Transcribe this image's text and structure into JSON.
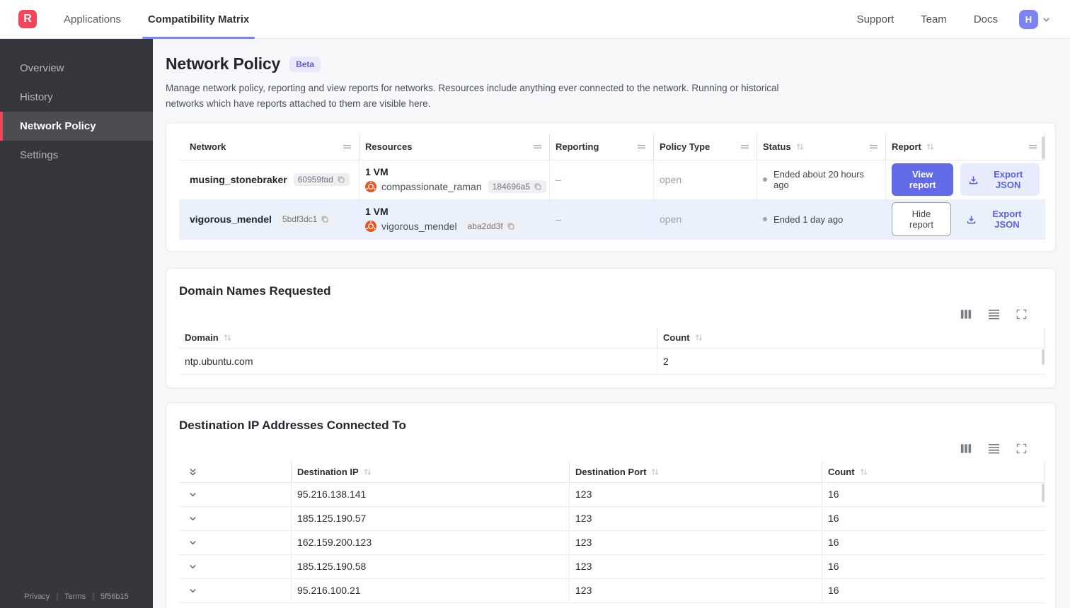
{
  "topnav": {
    "logo_letter": "R",
    "tabs": [
      {
        "label": "Applications"
      },
      {
        "label": "Compatibility Matrix"
      }
    ],
    "links": [
      {
        "label": "Support"
      },
      {
        "label": "Team"
      },
      {
        "label": "Docs"
      }
    ],
    "avatar_initial": "H"
  },
  "sidebar": {
    "items": [
      {
        "label": "Overview"
      },
      {
        "label": "History"
      },
      {
        "label": "Network Policy"
      },
      {
        "label": "Settings"
      }
    ],
    "footer": {
      "privacy": "Privacy",
      "terms": "Terms",
      "build": "5f56b15"
    }
  },
  "page": {
    "title": "Network Policy",
    "badge": "Beta",
    "description": "Manage network policy, reporting and view reports for networks. Resources include anything ever connected to the network. Running or historical networks which have reports attached to them are visible here."
  },
  "networks_table": {
    "headers": {
      "network": "Network",
      "resources": "Resources",
      "reporting": "Reporting",
      "policy_type": "Policy Type",
      "status": "Status",
      "report": "Report"
    },
    "rows": [
      {
        "name": "musing_stonebraker",
        "hash": "60959fad",
        "vm_count": "1 VM",
        "resource_name": "compassionate_raman",
        "resource_hash": "184696a5",
        "reporting": "–",
        "policy_type": "open",
        "status": "Ended about 20 hours ago",
        "report_label": "View report",
        "export_label": "Export JSON"
      },
      {
        "name": "vigorous_mendel",
        "hash": "5bdf3dc1",
        "vm_count": "1 VM",
        "resource_name": "vigorous_mendel",
        "resource_hash": "aba2dd3f",
        "reporting": "–",
        "policy_type": "open",
        "status": "Ended 1 day ago",
        "report_label": "Hide report",
        "export_label": "Export JSON"
      }
    ]
  },
  "domains_card": {
    "title": "Domain Names Requested",
    "headers": {
      "domain": "Domain",
      "count": "Count"
    },
    "rows": [
      {
        "domain": "ntp.ubuntu.com",
        "count": "2"
      }
    ]
  },
  "destinations_card": {
    "title": "Destination IP Addresses Connected To",
    "headers": {
      "ip": "Destination IP",
      "port": "Destination Port",
      "count": "Count"
    },
    "rows": [
      {
        "ip": "95.216.138.141",
        "port": "123",
        "count": "16"
      },
      {
        "ip": "185.125.190.57",
        "port": "123",
        "count": "16"
      },
      {
        "ip": "162.159.200.123",
        "port": "123",
        "count": "16"
      },
      {
        "ip": "185.125.190.58",
        "port": "123",
        "count": "16"
      },
      {
        "ip": "95.216.100.21",
        "port": "123",
        "count": "16"
      }
    ]
  },
  "colors": {
    "brand_red": "#f64458",
    "accent_indigo": "#636ae8",
    "row_highlight": "#e9f1fc",
    "ubuntu_orange": "#e95420",
    "sidebar_bg": "#35373b"
  }
}
